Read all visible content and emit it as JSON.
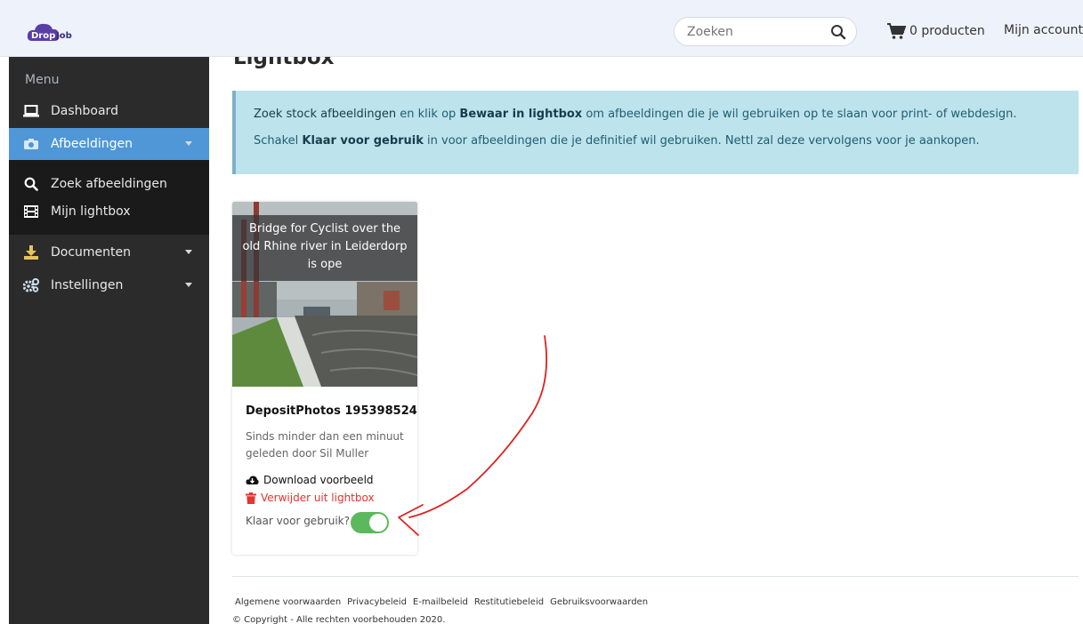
{
  "header": {
    "logo_left": "Drop",
    "logo_right": "Job",
    "search_placeholder": "Zoeken",
    "cart_label": "0 producten",
    "account_label": "Mijn account"
  },
  "sidebar": {
    "menu_title": "Menu",
    "items": [
      {
        "label": "Dashboard",
        "icon": "laptop-icon"
      },
      {
        "label": "Afbeeldingen",
        "icon": "camera-icon",
        "active": true
      },
      {
        "label": "Zoek afbeeldingen",
        "icon": "search-icon"
      },
      {
        "label": "Mijn lightbox",
        "icon": "film-icon"
      },
      {
        "label": "Documenten",
        "icon": "download-icon"
      },
      {
        "label": "Instellingen",
        "icon": "cogs-icon"
      }
    ]
  },
  "main": {
    "title": "Lightbox",
    "info": {
      "l1_a": "Zoek stock afbeeldingen",
      "l1_b": " en klik op ",
      "l1_c": "Bewaar in lightbox",
      "l1_d": " om afbeeldingen die je wil gebruiken op te slaan voor print- of webdesign.",
      "l2_a": "Schakel ",
      "l2_b": "Klaar voor gebruik",
      "l2_c": " in voor afbeeldingen die je definitief wil gebruiken. Nettl zal deze vervolgens voor je aankopen."
    },
    "card": {
      "overlay_text": "Bridge for Cyclist over the old Rhine river in Leiderdorp is ope",
      "title": "DepositPhotos 195398524",
      "meta": "Sinds minder dan een minuut geleden door Sil Muller",
      "download_label": "Download voorbeeld",
      "remove_label": "Verwijder uit lightbox",
      "ready_label": "Klaar voor gebruik?",
      "ready_on": true
    }
  },
  "footer": {
    "links": [
      "Algemene voorwaarden",
      "Privacybeleid",
      "E-mailbeleid",
      "Restitutiebeleid",
      "Gebruiksvoorwaarden"
    ],
    "copyright": "© Copyright - Alle rechten voorbehouden 2020."
  },
  "colors": {
    "sidebar_bg": "#2b2b2b",
    "active_item": "#4f97d6",
    "alert_bg": "#bde3ec",
    "toggle_on": "#5cb85c",
    "danger": "#e3342f",
    "annotation": "#e02020"
  }
}
